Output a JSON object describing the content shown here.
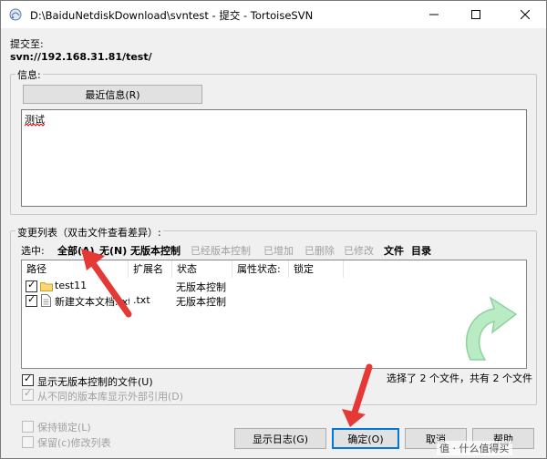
{
  "window": {
    "title": "D:\\BaiduNetdiskDownload\\svntest - 提交 - TortoiseSVN"
  },
  "commit_to": {
    "label": "提交至:",
    "url": "svn://192.168.31.81/test/"
  },
  "message": {
    "group_label": "信息:",
    "recent_button": "最近信息(R)",
    "text": "测试"
  },
  "changes": {
    "group_label": "变更列表（双击文件查看差异）:",
    "select_label": "选中:",
    "filters": [
      {
        "label": "全部(A)",
        "enabled": true
      },
      {
        "label": "无(N)",
        "enabled": true
      },
      {
        "label": "无版本控制",
        "enabled": true
      },
      {
        "label": "已经版本控制",
        "enabled": false
      },
      {
        "label": "已增加",
        "enabled": false
      },
      {
        "label": "已删除",
        "enabled": false
      },
      {
        "label": "已修改",
        "enabled": false
      },
      {
        "label": "文件",
        "enabled": true
      },
      {
        "label": "目录",
        "enabled": true
      }
    ],
    "columns": [
      "路径",
      "扩展名",
      "状态",
      "属性状态:",
      "锁定"
    ],
    "rows": [
      {
        "path": "test11",
        "ext": "",
        "status": "无版本控制",
        "icon": "folder-icon",
        "checked": true
      },
      {
        "path": "新建文本文档.txt",
        "ext": ".txt",
        "status": "无版本控制",
        "icon": "text-file-icon",
        "checked": true
      }
    ],
    "show_unversioned": {
      "label": "显示无版本控制的文件(U)",
      "checked": true
    },
    "show_externals": {
      "label": "从不同的版本库显示外部引用(D)",
      "checked": true,
      "enabled": false
    },
    "summary": "选择了 2 个文件，共有 2 个文件"
  },
  "options": {
    "keep_locks": {
      "label": "保持锁定(L)",
      "checked": false
    },
    "keep_changelists": {
      "label": "保留(c)修改列表",
      "checked": false
    }
  },
  "buttons": {
    "show_log": "显示日志(G)",
    "ok": "确定(O)",
    "cancel": "取消",
    "help": "帮助"
  },
  "watermark": "值 · 什么值得买",
  "colors": {
    "annotation_arrow": "#e53935",
    "focus": "#0078d7",
    "folder": "#f7d774",
    "update_arrow": "#b9ecc4"
  }
}
